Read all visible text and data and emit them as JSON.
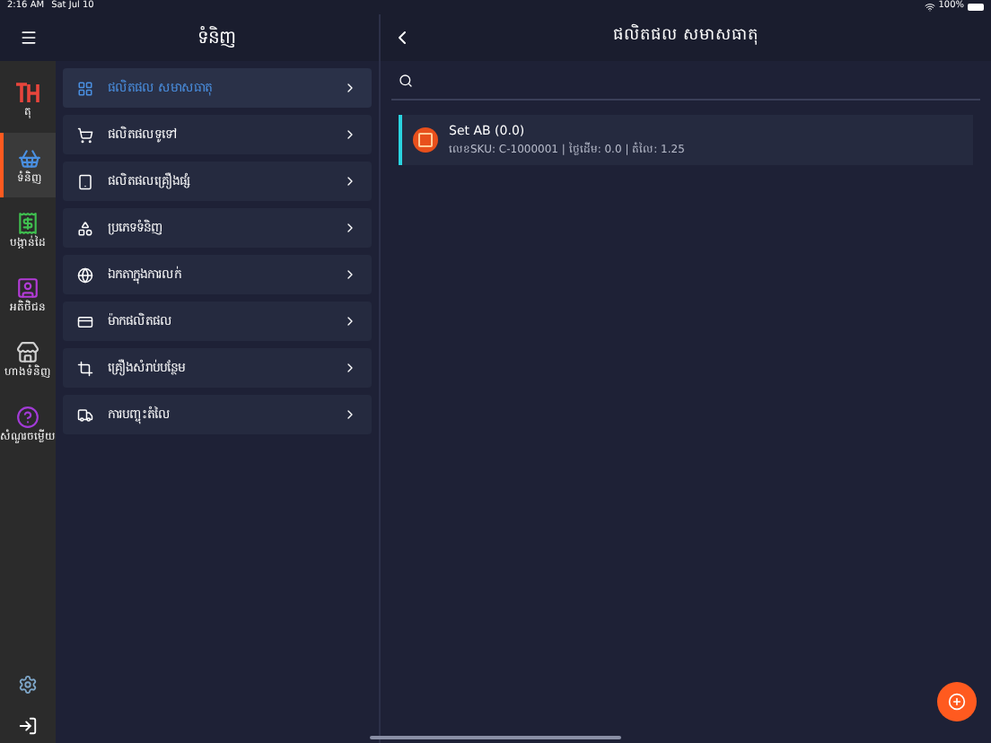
{
  "status_bar": {
    "time": "2:16 AM",
    "date": "Sat Jul 10",
    "battery": "100%"
  },
  "rail": {
    "items": [
      {
        "label": "តុ",
        "selected": false
      },
      {
        "label": "ទំនិញ",
        "selected": true
      },
      {
        "label": "បង្កាន់ដៃ",
        "selected": false
      },
      {
        "label": "អតិថិជន",
        "selected": false
      },
      {
        "label": "ហាងទំនិញ",
        "selected": false
      },
      {
        "label": "សំណួរចម្លើយ",
        "selected": false
      }
    ]
  },
  "menu": {
    "title": "ទំនិញ",
    "items": [
      {
        "label": "ផលិតផល សមាសធាតុ",
        "selected": true
      },
      {
        "label": "ផលិតផលទូទៅ",
        "selected": false
      },
      {
        "label": "ផលិតផលគ្រឿងផ្សំ",
        "selected": false
      },
      {
        "label": "ប្រភេទទំនិញ",
        "selected": false
      },
      {
        "label": "ឯកតាក្នុងការលក់",
        "selected": false
      },
      {
        "label": "ម៉ាកផលិតផល",
        "selected": false
      },
      {
        "label": "គ្រឿងសំរាប់បន្ថែម",
        "selected": false
      },
      {
        "label": "ការបញ្ចុះតំលៃ",
        "selected": false
      }
    ]
  },
  "detail": {
    "title": "ផលិតផល សមាសធាតុ",
    "products": [
      {
        "name": "Set AB (0.0)",
        "info": "លេខSKU: C-1000001 | ថ្លៃដើម: 0.0 | តំលៃ: 1.25"
      }
    ]
  }
}
